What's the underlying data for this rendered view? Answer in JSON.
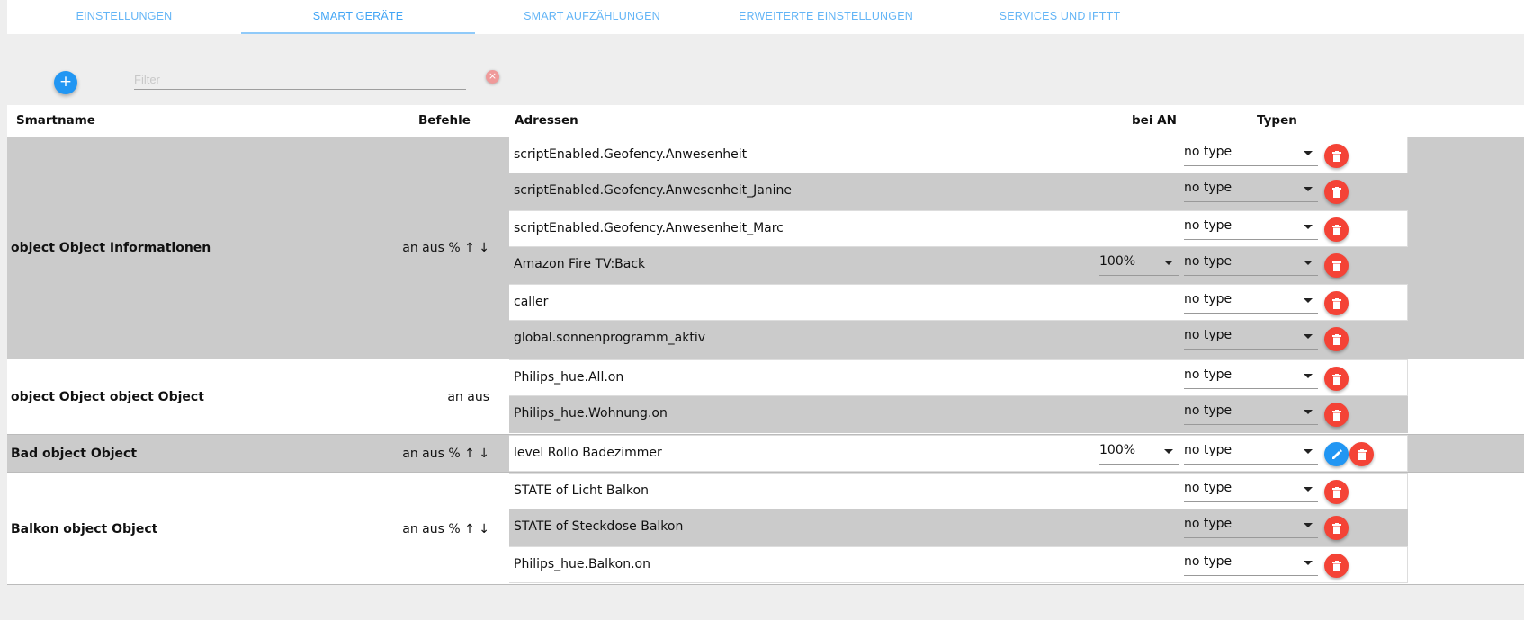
{
  "tabs": [
    {
      "label": "EINSTELLUNGEN",
      "active": false
    },
    {
      "label": "SMART GERÄTE",
      "active": true
    },
    {
      "label": "SMART AUFZÄHLUNGEN",
      "active": false
    },
    {
      "label": "ERWEITERTE EINSTELLUNGEN",
      "active": false
    },
    {
      "label": "SERVICES UND IFTTT",
      "active": false
    }
  ],
  "toolbar": {
    "add_label": "+",
    "filter_placeholder": "Filter",
    "filter_value": "",
    "clear_label": "×"
  },
  "table": {
    "headers": {
      "smartname": "Smartname",
      "befehle": "Befehle",
      "adressen": "Adressen",
      "bei_an": "bei AN",
      "typen": "Typen"
    },
    "groups": [
      {
        "name": "object Object Informationen",
        "commands": "an aus % ↑ ↓",
        "addresses": [
          {
            "name": "scriptEnabled.Geofency.Anwesenheit",
            "type": "no type"
          },
          {
            "name": "scriptEnabled.Geofency.Anwesenheit_Janine",
            "type": "no type"
          },
          {
            "name": "scriptEnabled.Geofency.Anwesenheit_Marc",
            "type": "no type"
          },
          {
            "name": "Amazon Fire TV:Back",
            "bei_an": "100%",
            "type": "no type"
          },
          {
            "name": "caller",
            "type": "no type"
          },
          {
            "name": "global.sonnenprogramm_aktiv",
            "type": "no type"
          }
        ]
      },
      {
        "name": "object Object object Object",
        "commands": "an aus",
        "addresses": [
          {
            "name": "Philips_hue.All.on",
            "type": "no type"
          },
          {
            "name": "Philips_hue.Wohnung.on",
            "type": "no type"
          }
        ]
      },
      {
        "name": "Bad object Object",
        "commands": "an aus % ↑ ↓",
        "addresses": [
          {
            "name": "level Rollo Badezimmer",
            "bei_an": "100%",
            "type": "no type",
            "editable": true
          }
        ]
      },
      {
        "name": "Balkon object Object",
        "commands": "an aus % ↑ ↓",
        "addresses": [
          {
            "name": "STATE of Licht Balkon",
            "type": "no type"
          },
          {
            "name": "STATE of Steckdose Balkon",
            "type": "no type"
          },
          {
            "name": "Philips_hue.Balkon.on",
            "type": "no type"
          }
        ]
      }
    ]
  },
  "colors": {
    "accent": "#2196f3",
    "delete": "#f44336",
    "tab_text": "#64b5f6",
    "row_grey": "#cbcbcb"
  }
}
